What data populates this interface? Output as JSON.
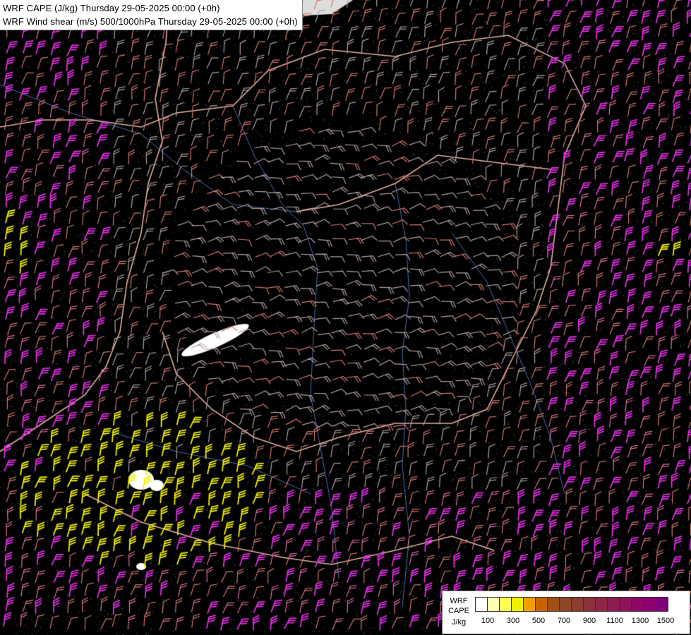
{
  "title": {
    "line1": "WRF CAPE (J/kg) Thursday 29-05-2025 00:00 (+0h)",
    "line2": "WRF Wind shear (m/s) 500/1000hPa Thursday 29-05-2025 00:00 (+0h)"
  },
  "legend": {
    "label_line1": "WRF",
    "label_line2": "CAPE",
    "label_line3": "J/kg",
    "swatch_colors": [
      "#ffffff",
      "#ffffb0",
      "#ffff50",
      "#f0f000",
      "#f0a000",
      "#c86400",
      "#a05014",
      "#8c4628",
      "#8c3c32",
      "#8c323c",
      "#8c2846",
      "#8c1e50",
      "#8c145a",
      "#8c0a64",
      "#8c0070",
      "#80007a"
    ],
    "ticks": [
      "100",
      "300",
      "500",
      "700",
      "900",
      "1100",
      "1300",
      "1500"
    ]
  },
  "map": {
    "background": "#000000",
    "barb_colors": {
      "low": "#b4a0a0",
      "mid": "#d27870",
      "high": "#e070a0",
      "strong": "#e030e0",
      "cape": "#f0f000"
    },
    "border_color": "#e0b0a0",
    "river_color": "#4a6fb0",
    "lake_color": "#ffffff"
  }
}
